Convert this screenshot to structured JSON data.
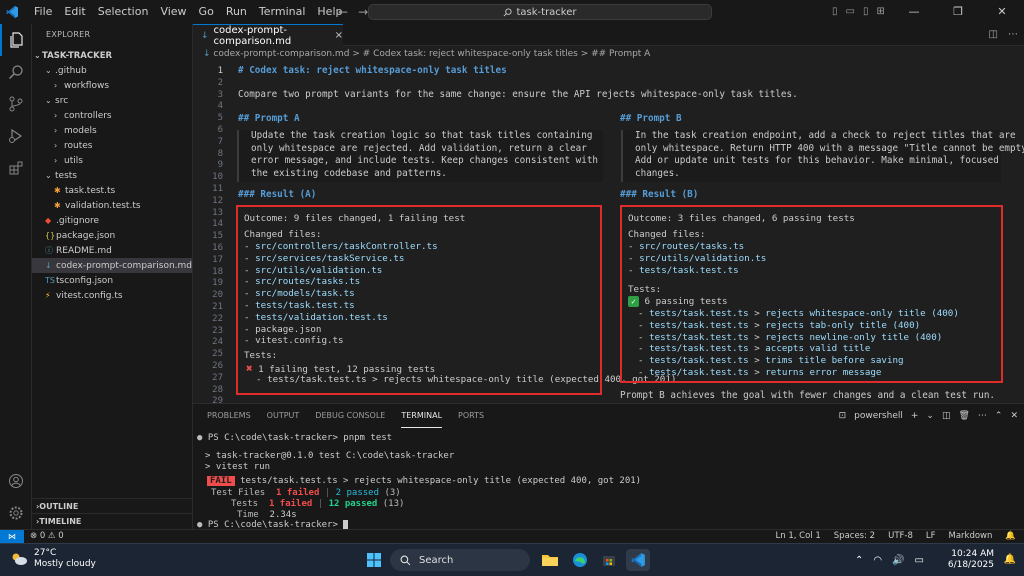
{
  "titlebar": {
    "menu": [
      "File",
      "Edit",
      "Selection",
      "View",
      "Go",
      "Run",
      "Terminal",
      "Help"
    ],
    "command_center": "task-tracker",
    "back_arrow": "←",
    "forward_arrow": "→"
  },
  "sidebar": {
    "title": "EXPLORER",
    "project": "TASK-TRACKER",
    "tree": [
      {
        "label": ".github",
        "kind": "folder-open",
        "depth": 1
      },
      {
        "label": "workflows",
        "kind": "folder",
        "depth": 2
      },
      {
        "label": "src",
        "kind": "folder-open",
        "depth": 1
      },
      {
        "label": "controllers",
        "kind": "folder",
        "depth": 2
      },
      {
        "label": "models",
        "kind": "folder",
        "depth": 2
      },
      {
        "label": "routes",
        "kind": "folder",
        "depth": 2
      },
      {
        "label": "utils",
        "kind": "folder",
        "depth": 2
      },
      {
        "label": "tests",
        "kind": "folder-open",
        "depth": 1
      },
      {
        "label": "task.test.ts",
        "kind": "test",
        "depth": 2
      },
      {
        "label": "validation.test.ts",
        "kind": "test",
        "depth": 2
      },
      {
        "label": ".gitignore",
        "kind": "git",
        "depth": 1
      },
      {
        "label": "package.json",
        "kind": "json",
        "depth": 1
      },
      {
        "label": "README.md",
        "kind": "info",
        "depth": 1
      },
      {
        "label": "codex-prompt-comparison.md",
        "kind": "md",
        "depth": 1,
        "selected": true
      },
      {
        "label": "tsconfig.json",
        "kind": "ts",
        "depth": 1
      },
      {
        "label": "vitest.config.ts",
        "kind": "vitest",
        "depth": 1
      }
    ],
    "outline": "OUTLINE",
    "timeline": "TIMELINE"
  },
  "editor": {
    "tab_label": "codex-prompt-comparison.md",
    "breadcrumb": "codex-prompt-comparison.md > # Codex task: reject whitespace-only task titles > ## Prompt A",
    "line_numbers": [
      "1",
      "2",
      "3",
      "4",
      "5",
      "6",
      "7",
      "8",
      "9",
      "10",
      "11",
      "12",
      "13",
      "14",
      "15",
      "16",
      "17",
      "18",
      "19",
      "20",
      "21",
      "22",
      "23",
      "24",
      "25",
      "26",
      "27",
      "28",
      "29"
    ],
    "h1": "# Codex task: reject whitespace-only task titles",
    "intro": "Compare two prompt variants for the same change: ensure the API rejects whitespace-only task titles.",
    "prompt_a_heading": "## Prompt A",
    "prompt_a_text": "Update the task creation logic so that task titles containing\nonly whitespace are rejected. Add validation, return a clear\nerror message, and include tests. Keep changes consistent with\nthe existing codebase and patterns.",
    "prompt_b_heading": "## Prompt B",
    "prompt_b_text": "In the task creation endpoint, add a check to reject titles that are\nonly whitespace. Return HTTP 400 with a message \"Title cannot be empty\".\nAdd or update unit tests for this behavior. Make minimal, focused\nchanges.",
    "result_a_heading": "### Result (A)",
    "result_b_heading": "### Result (B)",
    "result_a": {
      "outcome": "Outcome: 9 files changed, 1 failing test",
      "changed_label": "Changed files:",
      "files": [
        "src/controllers/taskController.ts",
        "src/services/taskService.ts",
        "src/utils/validation.ts",
        "src/routes/tasks.ts",
        "src/models/task.ts",
        "tests/task.test.ts",
        "tests/validation.test.ts",
        "package.json",
        "vitest.config.ts"
      ],
      "tests_label": "Tests:",
      "summary": "1 failing test, 12 passing tests",
      "failure": "- tests/task.test.ts > rejects whitespace-only title (expected 400, got 201)"
    },
    "result_b": {
      "outcome": "Outcome: 3 files changed, 6 passing tests",
      "changed_label": "Changed files:",
      "files": [
        "src/routes/tasks.ts",
        "src/utils/validation.ts",
        "tests/task.test.ts"
      ],
      "tests_label": "Tests:",
      "summary": "6 passing tests",
      "tests": [
        {
          "file": "tests/task.test.ts",
          "name": "rejects whitespace-only title (400)"
        },
        {
          "file": "tests/task.test.ts",
          "name": "rejects tab-only title (400)"
        },
        {
          "file": "tests/task.test.ts",
          "name": "rejects newline-only title (400)"
        },
        {
          "file": "tests/task.test.ts",
          "name": "accepts valid title"
        },
        {
          "file": "tests/task.test.ts",
          "name": "trims title before saving"
        },
        {
          "file": "tests/task.test.ts",
          "name": "returns error message"
        }
      ]
    },
    "conclusion": "Prompt B achieves the goal with fewer changes and a clean test run."
  },
  "panel": {
    "tabs": [
      "PROBLEMS",
      "OUTPUT",
      "DEBUG CONSOLE",
      "TERMINAL",
      "PORTS"
    ],
    "active_tab": "TERMINAL",
    "shell": "powershell",
    "lines": {
      "cmd": "PS C:\\code\\task-tracker> pnpm test",
      "l1": "> task-tracker@0.1.0 test C:\\code\\task-tracker",
      "l2": "> vitest run",
      "fail_badge": "FAIL",
      "fail_text": "tests/task.test.ts > rejects whitespace-only title (expected 400, got 201)",
      "files_label": "Test Files",
      "files_failed": "1 failed",
      "files_passed": "2 passed",
      "files_total": "(3)",
      "tests_label": "Tests",
      "tests_failed": "1 failed",
      "tests_passed": "12 passed",
      "tests_total": "(13)",
      "time_label": "Time",
      "time_value": "2.34s",
      "prompt": "PS C:\\code\\task-tracker>"
    }
  },
  "statusbar": {
    "problems": "⊗ 0  ⚠ 0",
    "position": "Ln 1, Col 1",
    "spaces": "Spaces: 2",
    "encoding": "UTF-8",
    "eol": "LF",
    "language": "Markdown"
  },
  "taskbar": {
    "temp": "27°C",
    "weather": "Mostly cloudy",
    "search": "Search",
    "time": "10:24 AM",
    "date": "6/18/2025"
  },
  "colors": {
    "accent": "#0078d4",
    "highlight_box": "#e02b2b",
    "heading": "#569cd6",
    "path": "#9cdcfe",
    "pass": "#23d18b",
    "fail": "#f14c4c"
  }
}
